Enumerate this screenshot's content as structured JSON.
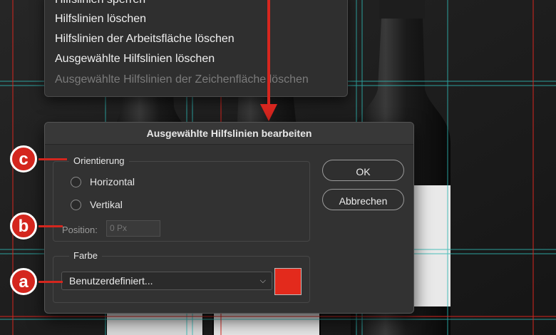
{
  "colors": {
    "accent": "#d4261e",
    "guide_cyan": "#2fb8b4",
    "guide_red": "#d7261f",
    "swatch": "#e32a1c"
  },
  "context_menu": {
    "items": [
      {
        "label": "Hilfslinien sperren",
        "enabled": true
      },
      {
        "label": "Hilfslinien löschen",
        "enabled": true
      },
      {
        "label": "Hilfslinien der Arbeitsfläche löschen",
        "enabled": true
      },
      {
        "label": "Ausgewählte Hilfslinien löschen",
        "enabled": true
      },
      {
        "label": "Ausgewählte Hilfslinien der Zeichenfläche löschen",
        "enabled": false
      }
    ]
  },
  "dialog": {
    "title": "Ausgewählte Hilfslinien bearbeiten",
    "orientation": {
      "legend": "Orientierung",
      "horizontal_label": "Horizontal",
      "vertical_label": "Vertikal",
      "position_label": "Position:",
      "position_placeholder": "0 Px"
    },
    "color": {
      "legend": "Farbe",
      "selected": "Benutzerdefiniert...",
      "swatch_hex": "#e32a1c"
    },
    "ok_label": "OK",
    "cancel_label": "Abbrechen"
  },
  "callouts": {
    "a": "a",
    "b": "b",
    "c": "c"
  }
}
